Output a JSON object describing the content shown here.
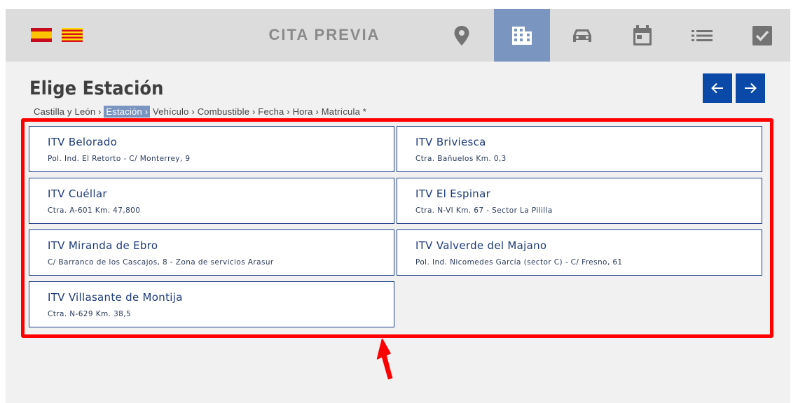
{
  "header": {
    "title": "CITA PREVIA",
    "languages": [
      {
        "name": "español",
        "icon": "flag-spain-icon"
      },
      {
        "name": "català",
        "icon": "flag-catalonia-icon"
      }
    ],
    "steps": [
      {
        "icon": "location-pin-icon",
        "active": false
      },
      {
        "icon": "building-icon",
        "active": true
      },
      {
        "icon": "car-icon",
        "active": false
      },
      {
        "icon": "calendar-icon",
        "active": false
      },
      {
        "icon": "list-icon",
        "active": false
      },
      {
        "icon": "checkbox-icon",
        "active": false
      }
    ],
    "active_color": "#7a96c0"
  },
  "page_title": "Elige Estación",
  "nav": {
    "prev_icon": "arrow-left-icon",
    "next_icon": "arrow-right-icon",
    "color": "#0b49a8"
  },
  "breadcrumb": [
    {
      "label": "Castilla y León ›",
      "active": false
    },
    {
      "label": "Estación ›",
      "active": true
    },
    {
      "label": "Vehículo ›",
      "active": false
    },
    {
      "label": "Combustible ›",
      "active": false
    },
    {
      "label": "Fecha ›",
      "active": false
    },
    {
      "label": "Hora ›",
      "active": false
    },
    {
      "label": "Matrícula *",
      "active": false
    }
  ],
  "stations": [
    {
      "name": "ITV Belorado",
      "address": "Pol. Ind. El Retorto - C/ Monterrey, 9"
    },
    {
      "name": "ITV Briviesca",
      "address": "Ctra. Bañuelos Km. 0,3"
    },
    {
      "name": "ITV Cuéllar",
      "address": "Ctra. A-601 Km. 47,800"
    },
    {
      "name": "ITV El Espinar",
      "address": "Ctra. N-VI Km. 67 - Sector La Pililla"
    },
    {
      "name": "ITV Miranda de Ebro",
      "address": "C/ Barranco de los Cascajos, 8 - Zona de servicios Arasur"
    },
    {
      "name": "ITV Valverde del Majano",
      "address": "Pol. Ind. Nicomedes García (sector C) - C/ Fresno, 61"
    },
    {
      "name": "ITV Villasante de Montija",
      "address": "Ctra. N-629 Km. 38,5"
    }
  ],
  "annotation": {
    "color": "#ff0000",
    "icon": "red-arrow-icon"
  }
}
